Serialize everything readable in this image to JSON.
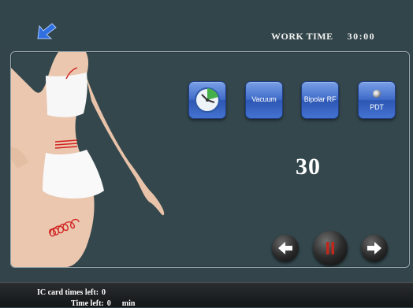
{
  "header": {
    "work_time_label": "WORK TIME",
    "work_time_value": "30:00",
    "back_icon": "back-arrow-icon"
  },
  "modes": [
    {
      "label": "",
      "icon": "clock-icon"
    },
    {
      "label": "Vacuum"
    },
    {
      "label": "Bipolar RF"
    },
    {
      "label": "PDT",
      "icon": "light-dot-icon"
    }
  ],
  "counter": "30",
  "controls": {
    "prev_icon": "arrow-left-icon",
    "pause_icon": "pause-icon",
    "next_icon": "arrow-right-icon"
  },
  "status": {
    "ic_card_label": "IC card times left:",
    "ic_card_value": "0",
    "time_left_label": "Time left:",
    "time_left_value": "0",
    "time_left_unit": "min"
  },
  "colors": {
    "background": "#33454a",
    "button_blue": "#3f6cc9",
    "pause_red": "#c0281c",
    "status_bar": "#1a1d1f"
  }
}
